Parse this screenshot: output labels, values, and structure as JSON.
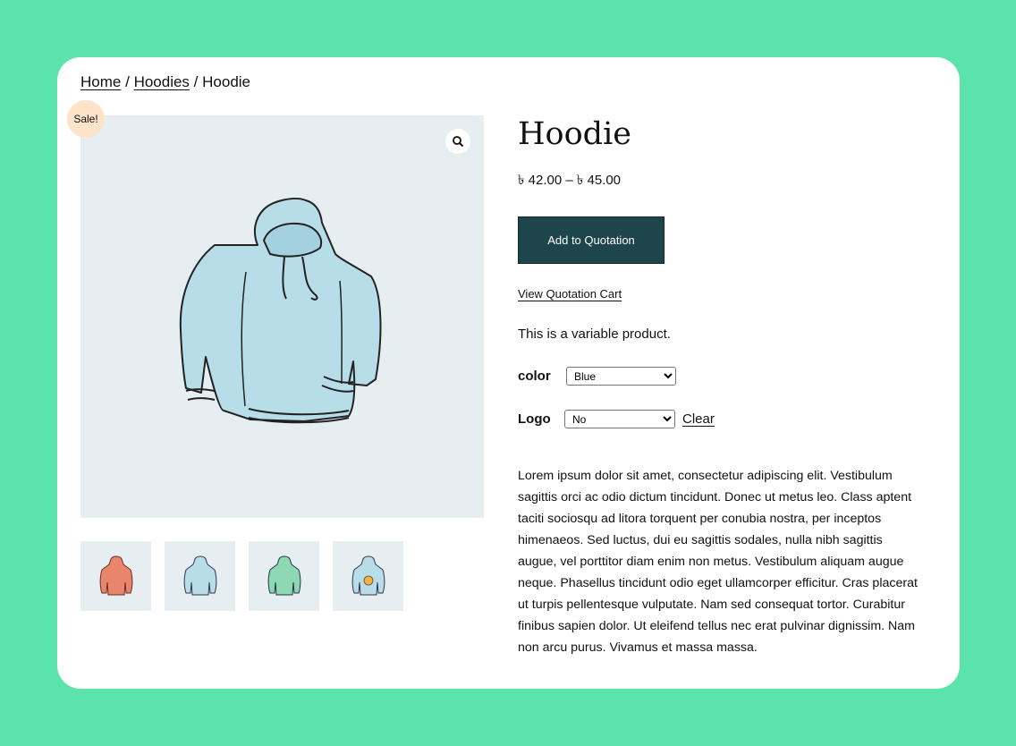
{
  "breadcrumb": {
    "home": "Home",
    "sep1": "/",
    "category": "Hoodies",
    "sep2": "/",
    "current": "Hoodie"
  },
  "badge": {
    "sale": "Sale!"
  },
  "product": {
    "title": "Hoodie",
    "price": "৳ 42.00 – ৳ 45.00",
    "add_button": "Add to Quotation",
    "view_cart": "View Quotation Cart",
    "short_description": "This is a variable product.",
    "long_description": "Lorem ipsum dolor sit amet, consectetur adipiscing elit. Vestibulum sagittis orci ac odio dictum tincidunt. Donec ut metus leo. Class aptent taciti sociosqu ad litora torquent per conubia nostra, per inceptos himenaeos. Sed luctus, dui eu sagittis sodales, nulla nibh sagittis augue, vel porttitor diam enim non metus. Vestibulum aliquam augue neque. Phasellus tincidunt odio eget ullamcorper efficitur. Cras placerat ut turpis pellentesque vulputate. Nam sed consequat tortor. Curabitur finibus sapien dolor. Ut eleifend tellus nec erat pulvinar dignissim. Nam non arcu purus. Vivamus et massa massa."
  },
  "variations": {
    "color": {
      "label": "color",
      "selected": "Blue"
    },
    "logo": {
      "label": "Logo",
      "selected": "No"
    },
    "clear": "Clear"
  },
  "gallery": {
    "main_image": "blue-hoodie-illustration",
    "zoom_icon": "magnifier-icon",
    "thumbnails": [
      "red-hoodie",
      "blue-hoodie",
      "green-hoodie",
      "blue-hoodie-with-logo"
    ]
  },
  "colors": {
    "background": "#5ae4ab",
    "card": "#ffffff",
    "button": "#1e454b",
    "sale_badge": "#fde3c8",
    "image_bg": "#e7eef2"
  }
}
